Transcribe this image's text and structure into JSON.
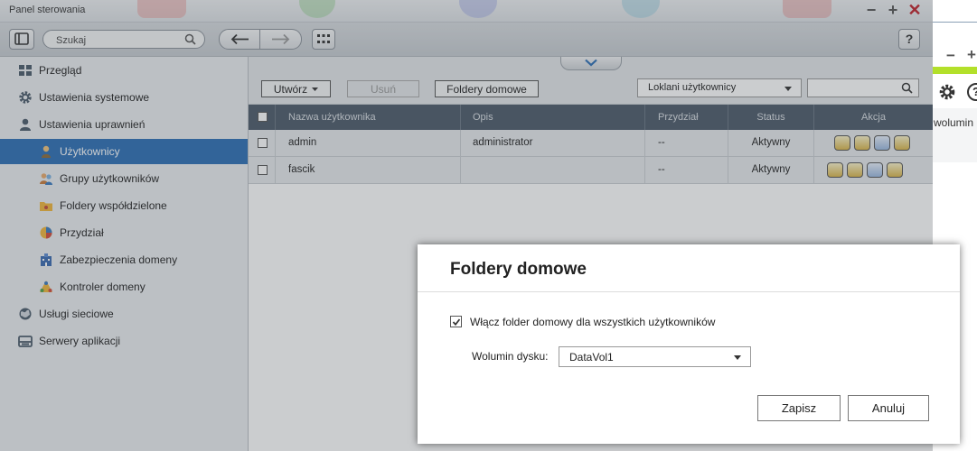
{
  "window": {
    "title": "Panel sterowania",
    "controls": {
      "minimize": "−",
      "maximize": "+",
      "close": "✕"
    }
  },
  "toolbar": {
    "search_placeholder": "Szukaj"
  },
  "sidebar": {
    "items": [
      {
        "label": "Przegląd",
        "icon": "grid-icon"
      },
      {
        "label": "Ustawienia systemowe",
        "icon": "gear-icon"
      },
      {
        "label": "Ustawienia uprawnień",
        "icon": "user-icon"
      },
      {
        "label": "Użytkownicy",
        "icon": "user-icon",
        "selected": true
      },
      {
        "label": "Grupy użytkowników",
        "icon": "users-icon"
      },
      {
        "label": "Foldery współdzielone",
        "icon": "folder-icon"
      },
      {
        "label": "Przydział",
        "icon": "pie-chart-icon"
      },
      {
        "label": "Zabezpieczenia domeny",
        "icon": "building-icon"
      },
      {
        "label": "Kontroler domeny",
        "icon": "network-icon"
      },
      {
        "label": "Usługi sieciowe",
        "icon": "globe-icon"
      },
      {
        "label": "Serwery aplikacji",
        "icon": "server-icon"
      }
    ]
  },
  "main": {
    "create_label": "Utwórz",
    "delete_label": "Usuń",
    "home_folders_label": "Foldery domowe",
    "filter_select": "Loklani użytkownicy",
    "table": {
      "columns": [
        "Nazwa użytkownika",
        "Opis",
        "Przydział",
        "Status",
        "Akcja"
      ],
      "rows": [
        {
          "name": "admin",
          "description": "administrator",
          "quota": "--",
          "status": "Aktywny"
        },
        {
          "name": "fascik",
          "description": "",
          "quota": "--",
          "status": "Aktywny"
        }
      ]
    }
  },
  "right_panel": {
    "text": "wolumin"
  },
  "dialog": {
    "title": "Foldery domowe",
    "enable_label": "Włącz folder domowy dla wszystkich użytkowników",
    "enable_checked": true,
    "volume_label": "Wolumin dysku:",
    "volume_value": "DataVol1",
    "save_label": "Zapisz",
    "cancel_label": "Anuluj"
  },
  "colors": {
    "selected": "#2b6eb5",
    "table_header": "#4c5968",
    "close": "#c0202a",
    "accent_green": "#b3e02a"
  }
}
